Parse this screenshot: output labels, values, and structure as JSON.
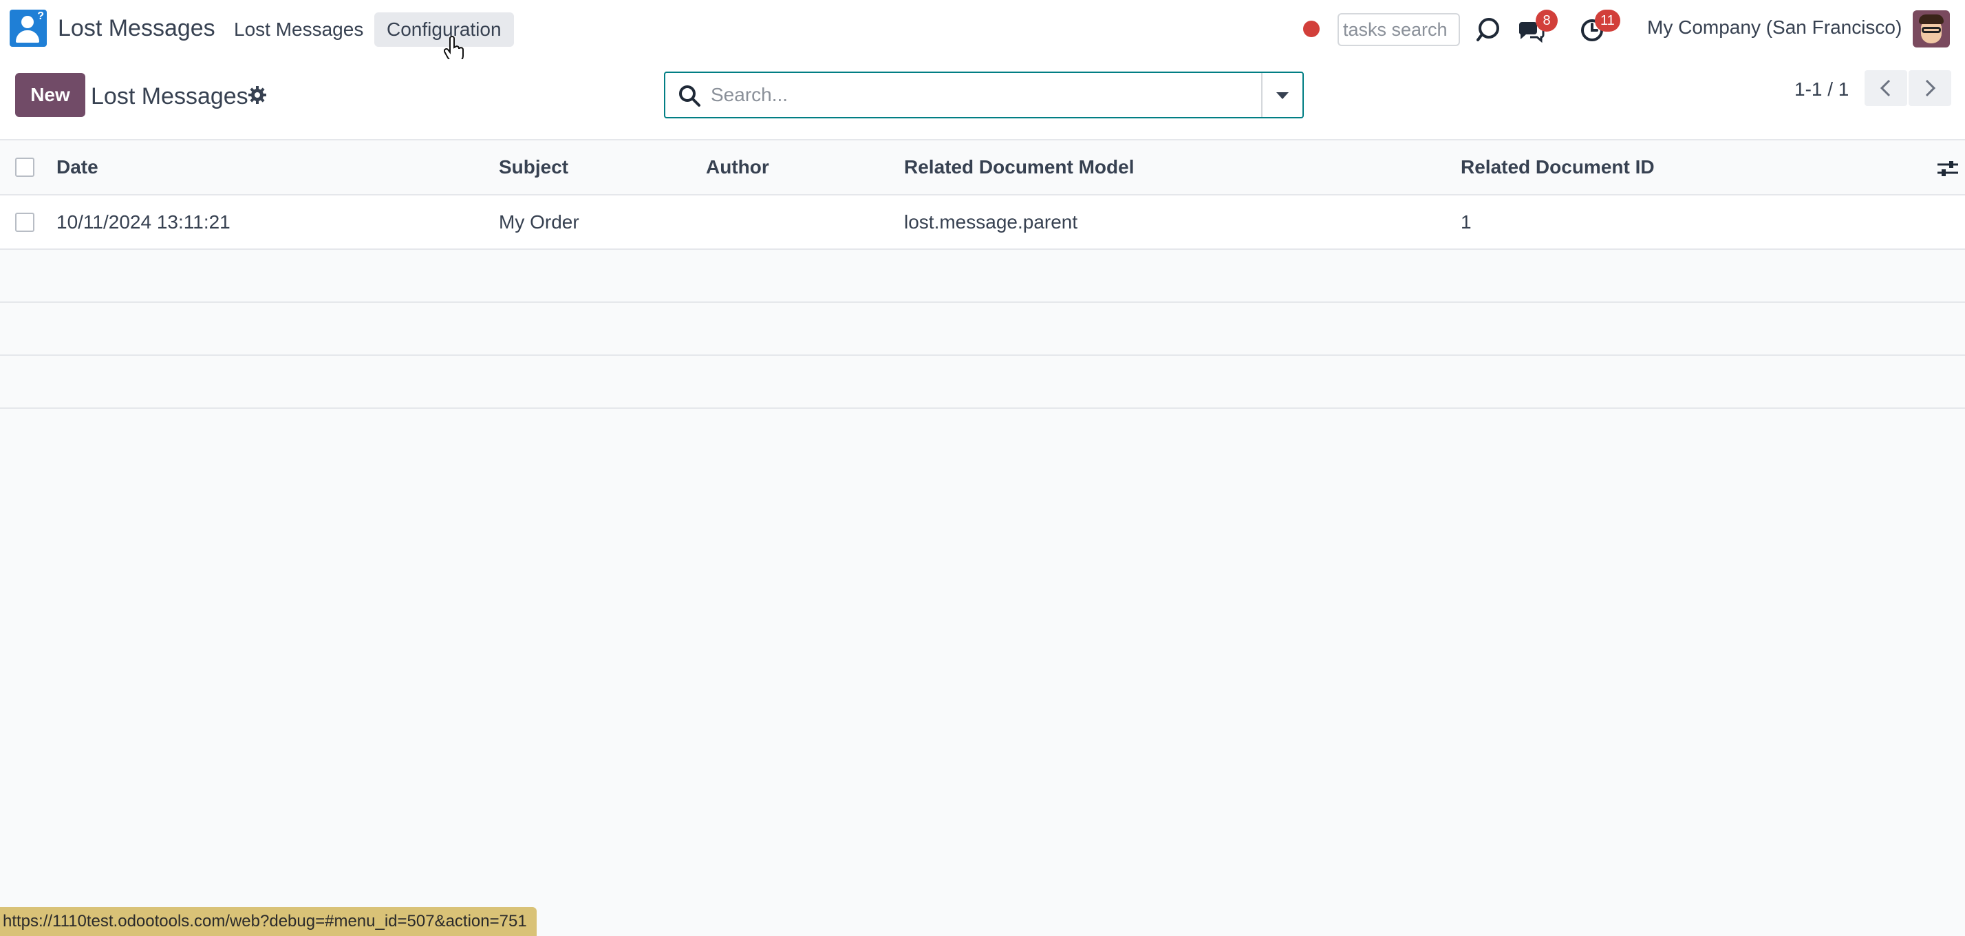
{
  "navbar": {
    "app_name": "Lost Messages",
    "menus": [
      "Lost Messages",
      "Configuration"
    ],
    "tasks_search_placeholder": "tasks search",
    "messages_badge": "8",
    "activities_badge": "11",
    "company": "My Company (San Francisco)"
  },
  "control_panel": {
    "new_label": "New",
    "title": "Lost Messages",
    "search_placeholder": "Search...",
    "pager_value": "1-1 / 1"
  },
  "list": {
    "columns": [
      "Date",
      "Subject",
      "Author",
      "Related Document Model",
      "Related Document ID"
    ],
    "rows": [
      {
        "date": "10/11/2024 13:11:21",
        "subject": "My Order",
        "author": "",
        "model": "lost.message.parent",
        "doc_id": "1"
      }
    ]
  },
  "status_url": "https://1110test.odootools.com/web?debug=#menu_id=507&action=751",
  "colors": {
    "primary": "#714b67",
    "search_border": "#017e84",
    "badge": "#d23f3a",
    "app_icon": "#1f7fd6"
  },
  "icons": [
    "app-icon",
    "record-dot-icon",
    "bug-icon",
    "chat-icon",
    "clock-icon",
    "gear-icon",
    "search-icon",
    "caret-down-icon",
    "chevron-left-icon",
    "chevron-right-icon",
    "sliders-icon",
    "pointer-cursor-icon"
  ]
}
